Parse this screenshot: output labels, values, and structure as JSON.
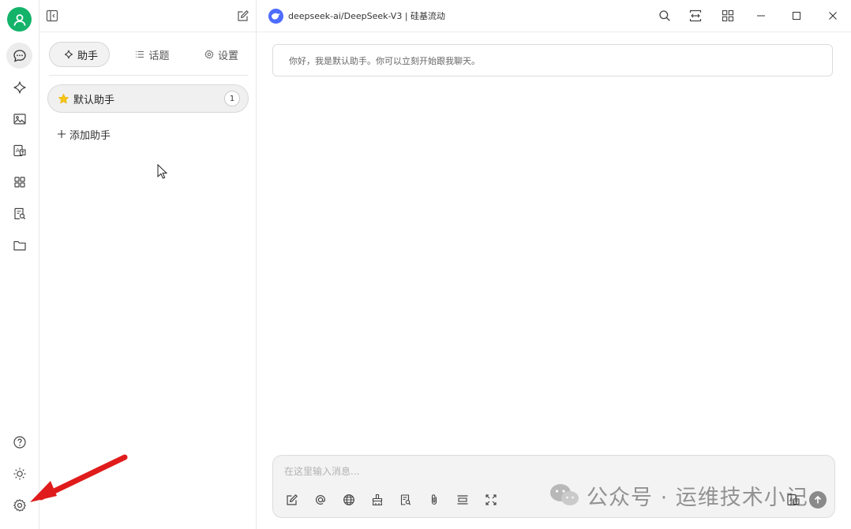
{
  "app": {
    "model_name": "deepseek-ai/DeepSeek-V3 | 硅基流动"
  },
  "panel": {
    "tabs": [
      {
        "label": "助手",
        "icon": "sparkle-icon",
        "active": true
      },
      {
        "label": "话题",
        "icon": "list-icon",
        "active": false
      },
      {
        "label": "设置",
        "icon": "gear-icon",
        "active": false
      }
    ],
    "assistants": [
      {
        "name": "默认助手",
        "count": "1",
        "icon": "star-icon"
      }
    ],
    "add_label": "添加助手"
  },
  "rail": {
    "top_icons": [
      "chat-icon",
      "sparkle-icon",
      "image-icon",
      "translate-icon",
      "apps-icon",
      "doc-search-icon",
      "folder-icon"
    ],
    "bottom_icons": [
      "help-icon",
      "sun-icon",
      "settings-icon"
    ]
  },
  "chat": {
    "greeting": "你好，我是默认助手。你可以立刻开始跟我聊天。",
    "input_placeholder": "在这里输入消息..."
  },
  "watermark": {
    "text": "公众号 · 运维技术小记"
  },
  "colors": {
    "accent": "#13b36a",
    "model_logo": "#4d6bfe",
    "annotation_arrow": "#e01b1b"
  }
}
